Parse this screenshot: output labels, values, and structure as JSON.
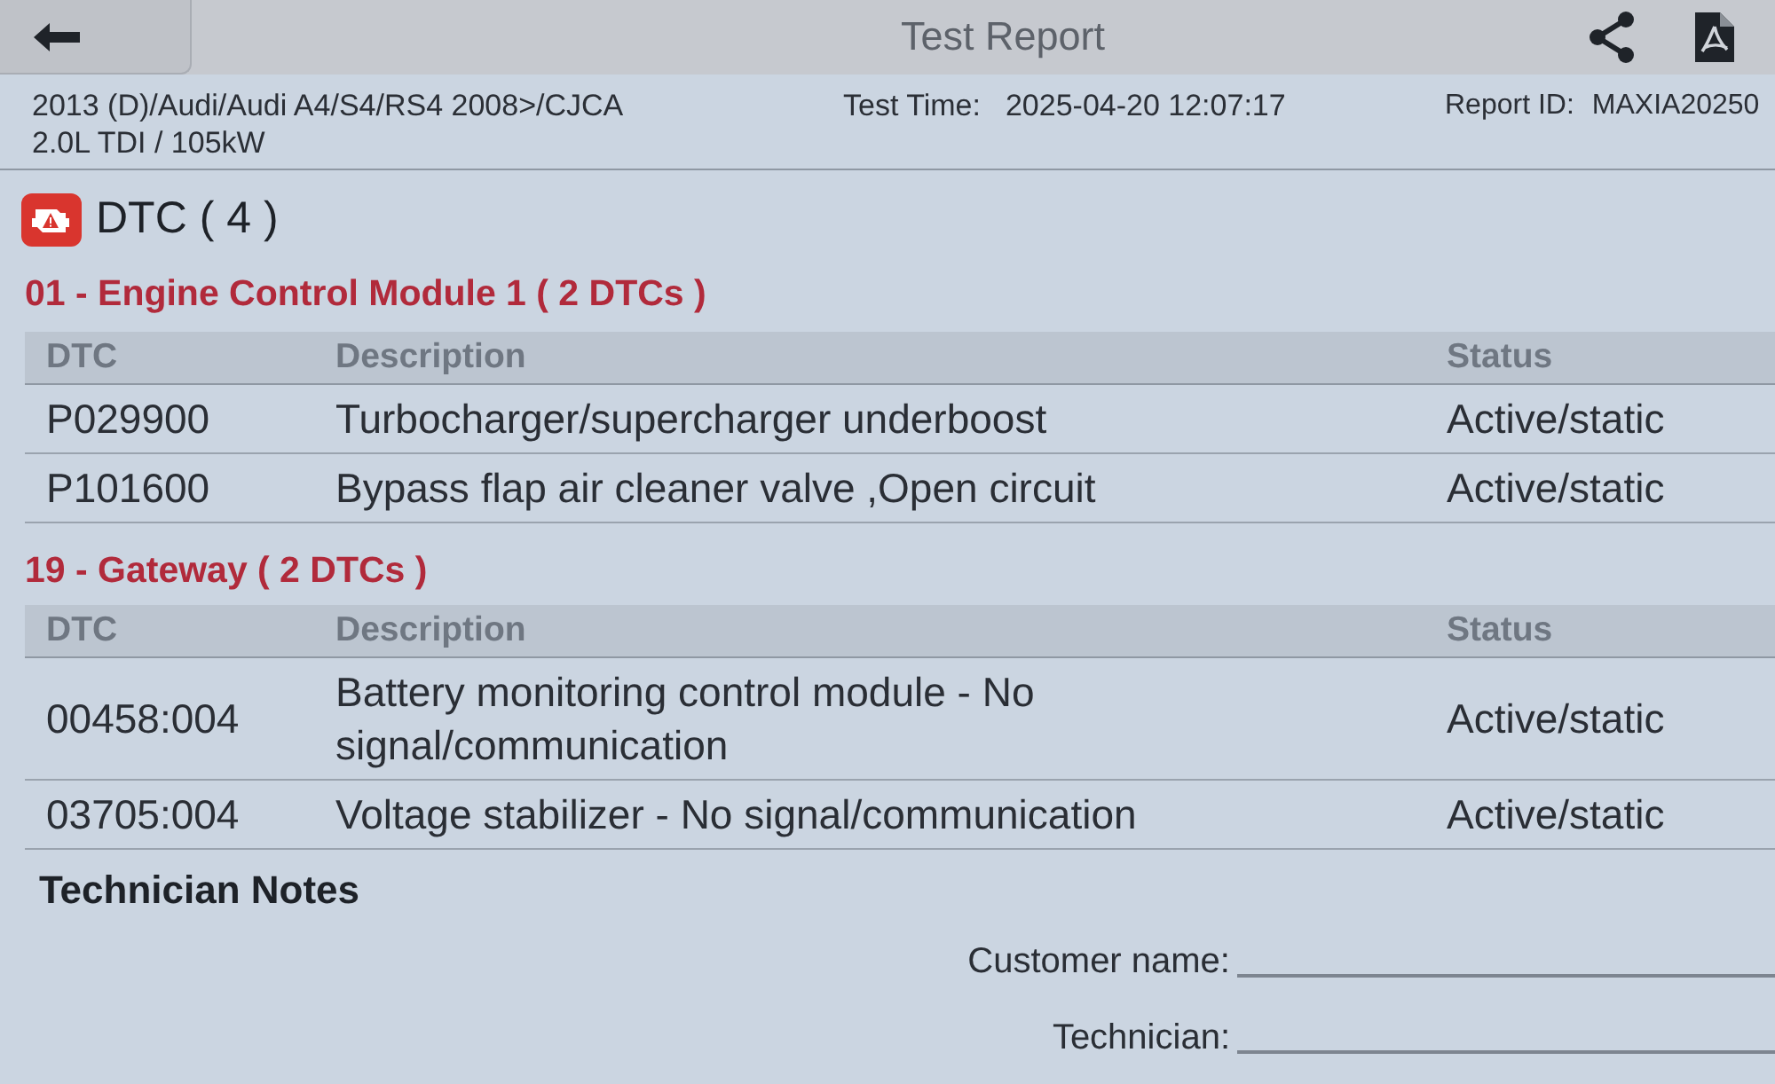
{
  "header": {
    "title": "Test Report"
  },
  "vehicle_info": {
    "lines": [
      "2013 (D)/Audi/Audi A4/S4/RS4 2008>/CJCA",
      "2.0L TDI / 105kW"
    ]
  },
  "test_time": {
    "label": "Test Time:",
    "value": "2025-04-20 12:07:17"
  },
  "report_id": {
    "label": "Report ID:",
    "value": "MAXIA20250"
  },
  "dtc_section": {
    "title": "DTC ( 4 )",
    "modules": [
      {
        "title": "01 - Engine Control Module 1 ( 2 DTCs )",
        "columns": [
          "DTC",
          "Description",
          "Status"
        ],
        "rows": [
          {
            "dtc": "P029900",
            "description": "Turbocharger/supercharger underboost",
            "status": "Active/static"
          },
          {
            "dtc": "P101600",
            "description": "Bypass flap air cleaner valve ,Open circuit",
            "status": "Active/static"
          }
        ]
      },
      {
        "title": "19 - Gateway ( 2 DTCs )",
        "columns": [
          "DTC",
          "Description",
          "Status"
        ],
        "rows": [
          {
            "dtc": "00458:004",
            "description": "Battery monitoring control module - No signal/communication",
            "status": "Active/static"
          },
          {
            "dtc": "03705:004",
            "description": "Voltage stabilizer - No signal/communication",
            "status": "Active/static"
          }
        ]
      }
    ]
  },
  "technician_notes": {
    "title": "Technician Notes"
  },
  "signature_fields": [
    {
      "label": "Customer name:"
    },
    {
      "label": "Technician:"
    }
  ]
}
